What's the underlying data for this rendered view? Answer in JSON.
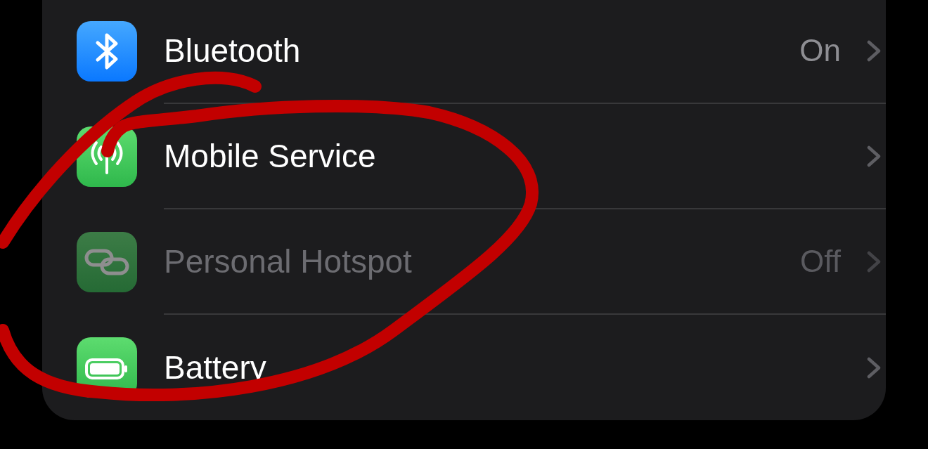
{
  "settings_list": {
    "items": [
      {
        "label": "Bluetooth",
        "value": "On",
        "disabled": false
      },
      {
        "label": "Mobile Service",
        "disabled": false
      },
      {
        "label": "Personal Hotspot",
        "value": "Off",
        "disabled": true
      },
      {
        "label": "Battery",
        "disabled": false
      }
    ]
  }
}
